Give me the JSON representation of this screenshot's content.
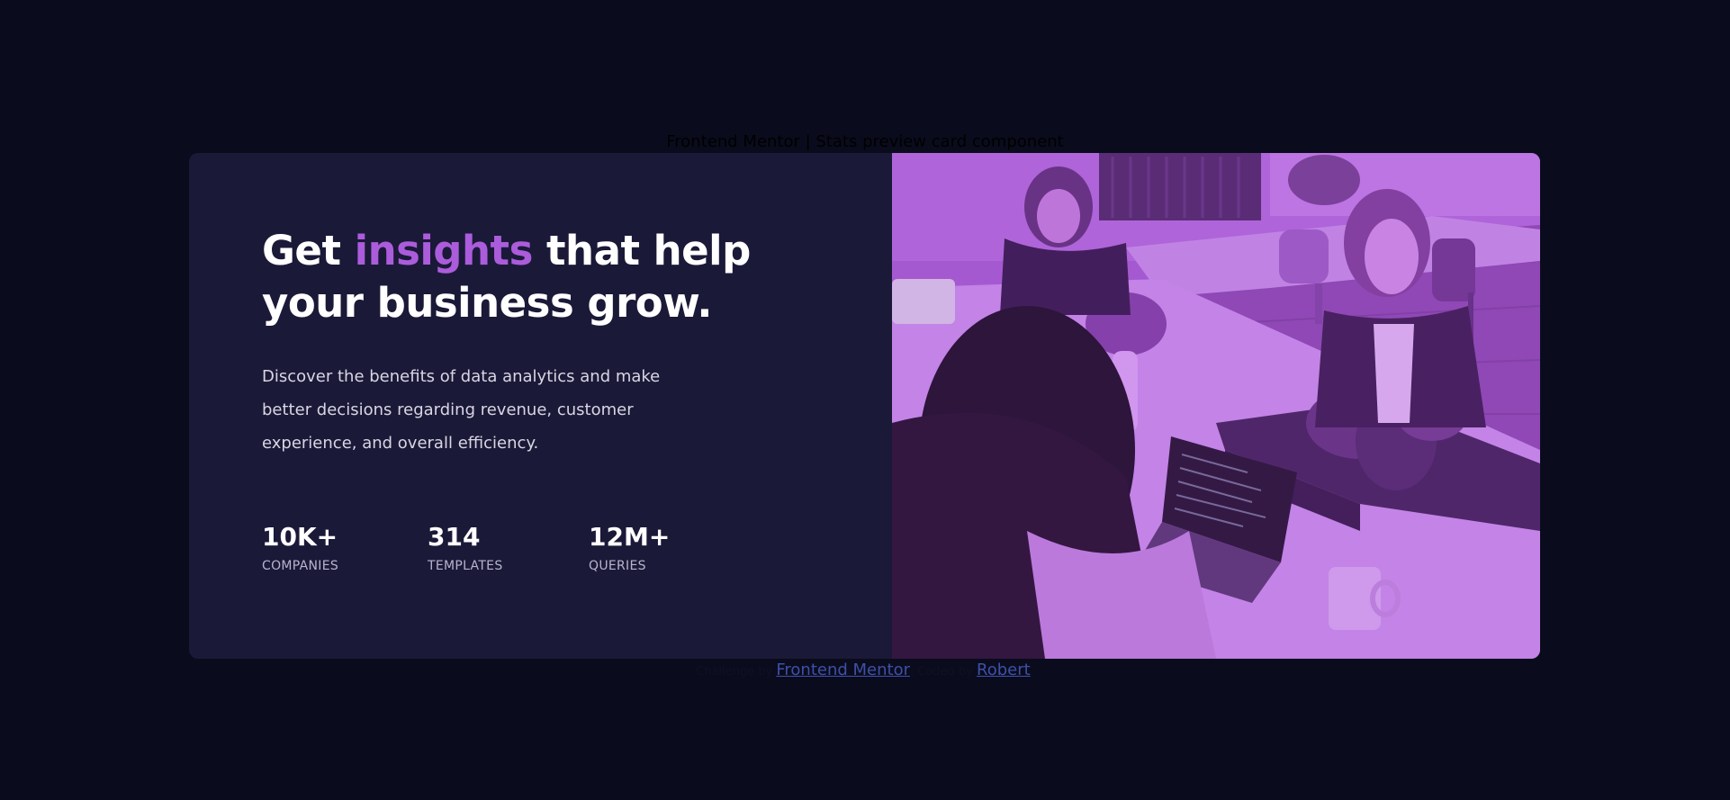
{
  "page": {
    "title": "Frontend Mentor | Stats preview card component",
    "colors": {
      "background": "#0a0c1d",
      "card": "#1b1938",
      "accent": "#ab5cdb",
      "image_tint": "#aa5cdb",
      "link": "#3f4fa8"
    }
  },
  "card": {
    "headline_before": "Get ",
    "headline_accent": "insights",
    "headline_after": " that help your business grow.",
    "description": "Discover the benefits of data analytics and make better decisions regarding revenue, customer experience, and overall efficiency.",
    "stats": [
      {
        "value": "10K+",
        "label": "COMPANIES"
      },
      {
        "value": "314",
        "label": "TEMPLATES"
      },
      {
        "value": "12M+",
        "label": "QUERIES"
      }
    ],
    "image_icon": "office-team-photo"
  },
  "attribution": {
    "prefix": "Challenge by",
    "challenge_link": "Frontend Mentor",
    "middle": "Coded by",
    "author_link": "Robert"
  }
}
